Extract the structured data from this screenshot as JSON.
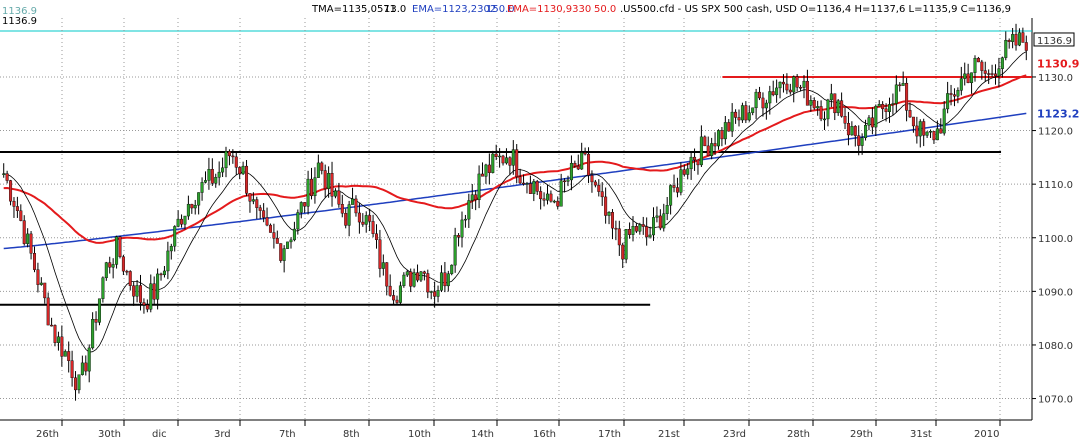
{
  "header": {
    "tma": "TMA=1135,0571",
    "tma_period": "13.0",
    "ema1": "EMA=1123,2302",
    "ema1_period": "150.0",
    "ema2": "EMA=1130,9330",
    "ema2_period": "50.0",
    "symbol": ".US500.cfd - US SPX 500 cash, USD O=1136,4 H=1137,6 L=1135,9 C=1136,9",
    "corner_value": "1136.9",
    "corner_value_top": "1136.9"
  },
  "chart_data": {
    "type": "candlestick",
    "title": "",
    "ylim": [
      1066,
      1141
    ],
    "y_ticks": [
      1070,
      1080,
      1090,
      1100,
      1110,
      1120,
      1130
    ],
    "y_tick_labels": [
      "1070.0",
      "1080.0",
      "1090.0",
      "1100.0",
      "1110.0",
      "1120.0",
      "1130.0"
    ],
    "x_tick_labels": [
      "26th",
      "30th",
      "dic",
      "3rd",
      "7th",
      "8th",
      "10th",
      "14th",
      "16th",
      "17th",
      "21st",
      "23rd",
      "28th",
      "29th",
      "31st",
      "2010"
    ],
    "price_labels": {
      "last": "1136.9",
      "ema50": "1130.9",
      "ema150": "1123.2"
    },
    "hlines": [
      {
        "name": "resistance-1130",
        "y": 1130.0,
        "x_from": 0.7,
        "x_to": 1.0,
        "color": "#e41a1c"
      },
      {
        "name": "support-1116",
        "y": 1116.0,
        "x_from": 0.0,
        "x_to": 0.97,
        "color": "#000000"
      },
      {
        "name": "support-1087",
        "y": 1087.5,
        "x_from": 0.0,
        "x_to": 0.63,
        "color": "#000000"
      }
    ],
    "anchors": [
      1112,
      1106,
      1098,
      1090,
      1082,
      1078,
      1072,
      1082,
      1094,
      1098,
      1092,
      1088,
      1090,
      1097,
      1104,
      1108,
      1110,
      1112,
      1116,
      1112,
      1104,
      1100,
      1098,
      1102,
      1108,
      1114,
      1108,
      1104,
      1106,
      1102,
      1094,
      1090,
      1092,
      1095,
      1090,
      1093,
      1102,
      1108,
      1112,
      1114,
      1116,
      1112,
      1110,
      1106,
      1108,
      1112,
      1114,
      1108,
      1102,
      1098,
      1102,
      1100,
      1104,
      1108,
      1114,
      1116,
      1118,
      1120,
      1122,
      1124,
      1126,
      1128,
      1130,
      1128,
      1126,
      1124,
      1126,
      1120,
      1118,
      1122,
      1126,
      1128,
      1122,
      1118,
      1120,
      1126,
      1130,
      1132,
      1130,
      1134,
      1136,
      1137
    ],
    "ema50": {
      "name": "EMA 50",
      "color": "#e41a1c",
      "start": 1106,
      "end": 1130.9
    },
    "ema150": {
      "name": "EMA 150",
      "color": "#1f3fbf",
      "start": 1098,
      "end": 1123.2
    },
    "tma": {
      "name": "TMA 13",
      "color": "#000000"
    },
    "colors": {
      "up": "#2ca02c",
      "down": "#d62728",
      "grid": "#999999",
      "cyan": "#00c8c8"
    }
  }
}
